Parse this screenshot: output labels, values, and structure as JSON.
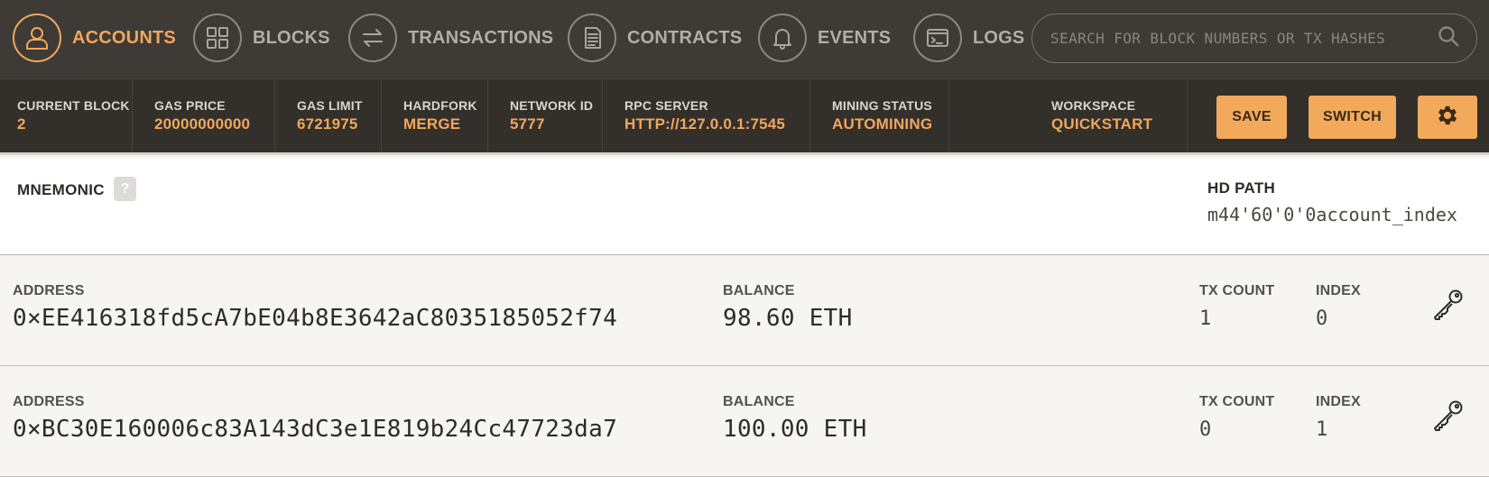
{
  "nav": {
    "items": [
      {
        "label": "ACCOUNTS",
        "icon": "user-icon",
        "active": true
      },
      {
        "label": "BLOCKS",
        "icon": "grid-icon",
        "active": false
      },
      {
        "label": "TRANSACTIONS",
        "icon": "swap-arrows-icon",
        "active": false
      },
      {
        "label": "CONTRACTS",
        "icon": "document-icon",
        "active": false
      },
      {
        "label": "EVENTS",
        "icon": "bell-icon",
        "active": false
      },
      {
        "label": "LOGS",
        "icon": "terminal-icon",
        "active": false
      }
    ],
    "search": {
      "placeholder": "SEARCH FOR BLOCK NUMBERS OR TX HASHES",
      "icon": "search-icon"
    }
  },
  "status": {
    "current_block": {
      "label": "CURRENT BLOCK",
      "value": "2"
    },
    "gas_price": {
      "label": "GAS PRICE",
      "value": "20000000000"
    },
    "gas_limit": {
      "label": "GAS LIMIT",
      "value": "6721975"
    },
    "hardfork": {
      "label": "HARDFORK",
      "value": "MERGE"
    },
    "network_id": {
      "label": "NETWORK ID",
      "value": "5777"
    },
    "rpc_server": {
      "label": "RPC SERVER",
      "value": "HTTP://127.0.0.1:7545"
    },
    "mining_status": {
      "label": "MINING STATUS",
      "value": "AUTOMINING"
    },
    "workspace": {
      "label": "WORKSPACE",
      "value": "QUICKSTART"
    },
    "save_label": "SAVE",
    "switch_label": "SWITCH",
    "settings_icon": "gear-icon"
  },
  "mnemonic": {
    "label": "MNEMONIC",
    "help": "?",
    "hd_path_label": "HD PATH",
    "hd_path_value": "m44'60'0'0account_index"
  },
  "accounts": [
    {
      "address_label": "ADDRESS",
      "address": "0×EE416318fd5cA7bE04b8E3642aC8035185052f74",
      "balance_label": "BALANCE",
      "balance": "98.60 ETH",
      "tx_count_label": "TX COUNT",
      "tx_count": "1",
      "index_label": "INDEX",
      "index": "0",
      "icon": "key-icon"
    },
    {
      "address_label": "ADDRESS",
      "address": "0×BC30E160006c83A143dC3e1E819b24Cc47723da7",
      "balance_label": "BALANCE",
      "balance": "100.00 ETH",
      "tx_count_label": "TX COUNT",
      "tx_count": "0",
      "index_label": "INDEX",
      "index": "1",
      "icon": "key-icon"
    }
  ],
  "colors": {
    "accent": "#f0a75c",
    "nav_bg": "#3e3a36",
    "status_bg": "#332f2b",
    "row_bg": "#f6f5f1"
  }
}
